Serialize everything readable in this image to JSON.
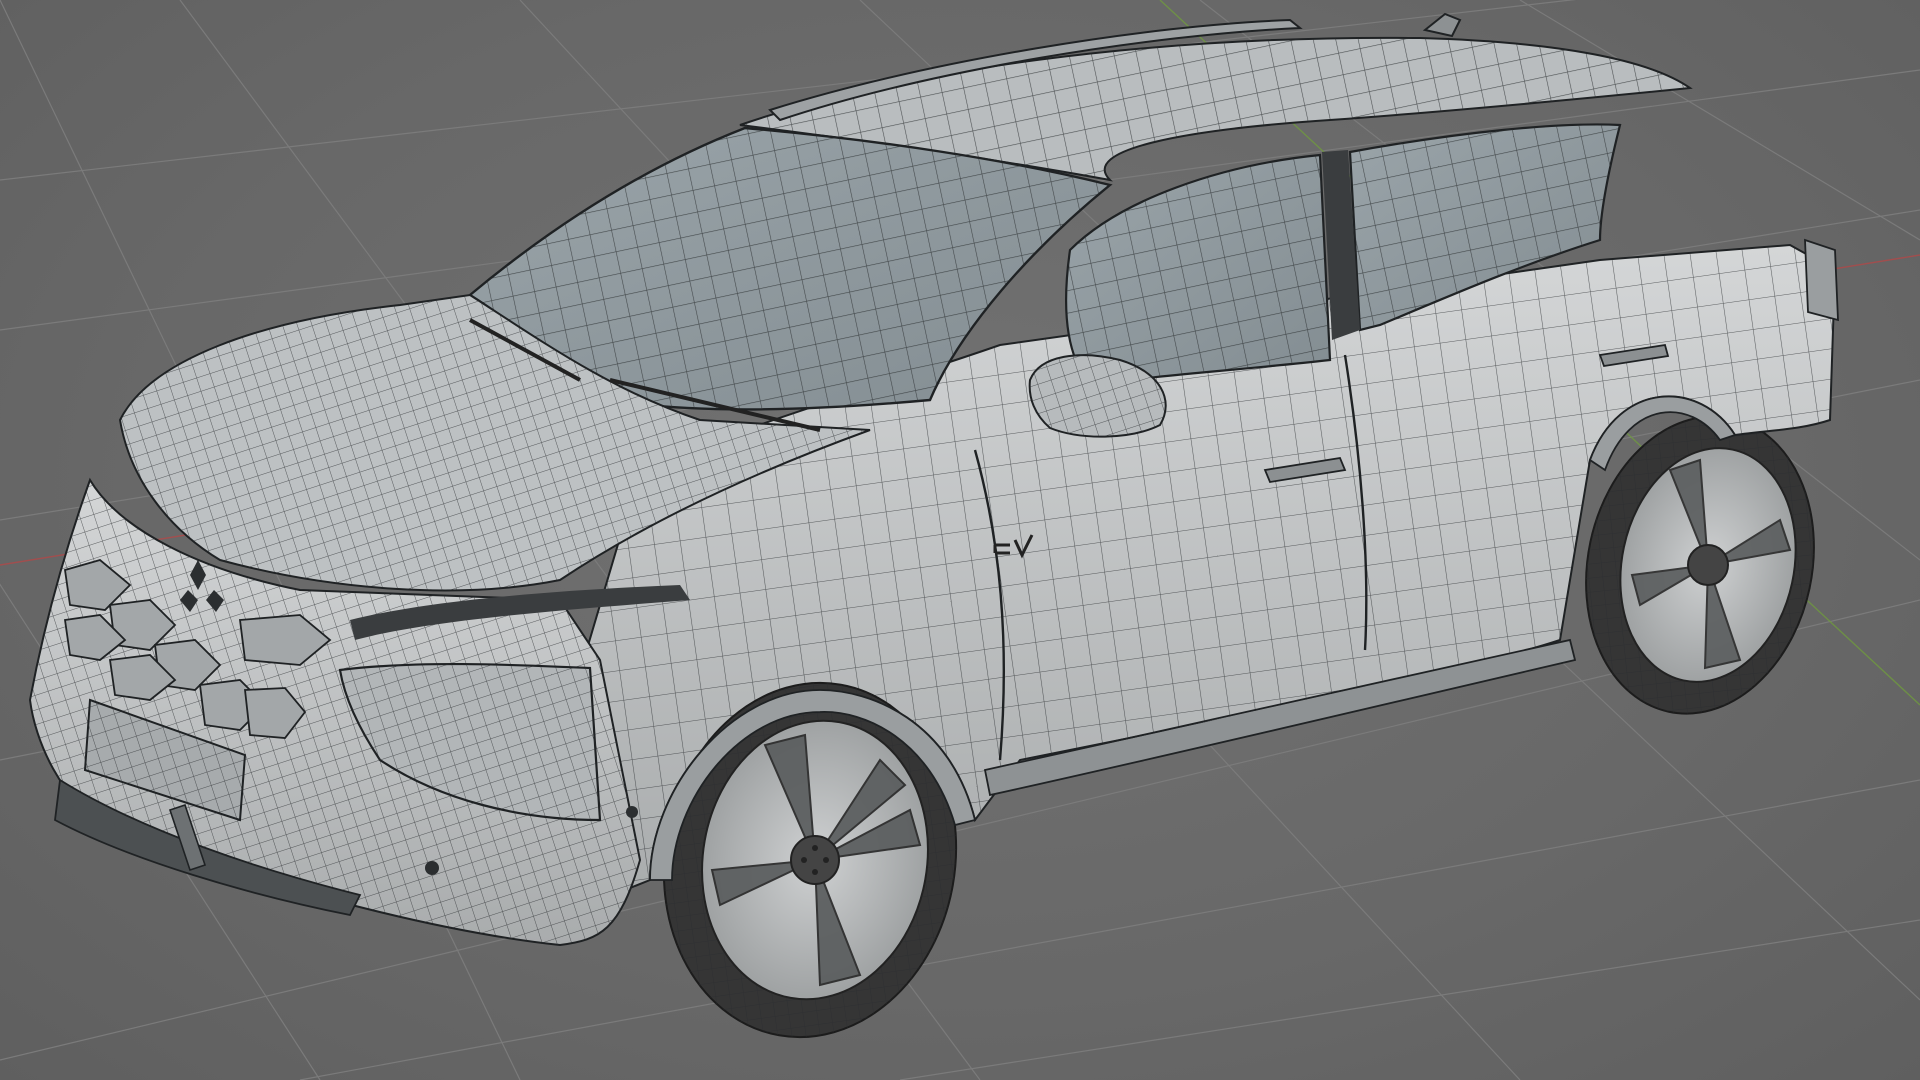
{
  "app": {
    "viewport_label": "",
    "display_mode": "wireframe-overlay",
    "colors": {
      "background": "#6b6b6b",
      "grid": "#7a7a7a",
      "axis_x": "#b04848",
      "axis_y": "#6f9a3f",
      "body_light": "#c9cbcc",
      "body_shadow": "#9a9d9f",
      "glass": "#8f999e",
      "wire": "#2b2e30",
      "tire": "#3a3a3a",
      "rim": "#bfc2c3"
    },
    "model": {
      "name_icon": "car-mesh-icon",
      "badge_icon": "mitsubishi-logo-icon",
      "side_badge_icon": "ev-badge-icon"
    }
  }
}
